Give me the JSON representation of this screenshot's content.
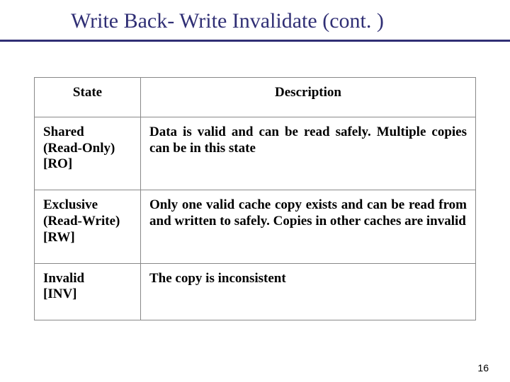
{
  "title": "Write Back- Write Invalidate (cont. )",
  "headers": {
    "state": "State",
    "desc": "Description"
  },
  "rows": [
    {
      "state": "Shared\n(Read-Only)\n[RO]",
      "desc": "Data is valid and can be read safely. Multiple copies can be in this state"
    },
    {
      "state": "Exclusive\n(Read-Write)\n[RW]",
      "desc": "Only one valid cache copy exists and can be read from and written to safely. Copies in other caches are invalid"
    },
    {
      "state": "Invalid\n[INV]",
      "desc": "The copy is inconsistent"
    }
  ],
  "page_number": "16"
}
